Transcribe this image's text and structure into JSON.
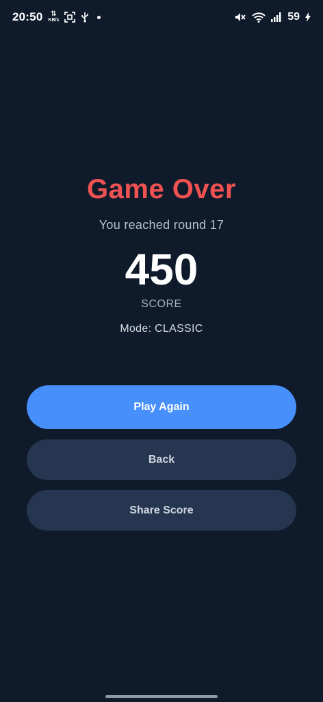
{
  "status_bar": {
    "time": "20:50",
    "net_speed_unit": "KB/s",
    "battery": "59"
  },
  "game_over": {
    "title": "Game Over",
    "subtitle": "You reached round 17",
    "score": "450",
    "score_label": "SCORE",
    "mode": "Mode: CLASSIC"
  },
  "buttons": {
    "play_again": "Play Again",
    "back": "Back",
    "share_score": "Share Score"
  },
  "colors": {
    "background": "#0f1b2b",
    "title": "#f05252",
    "primary_button": "#478ffb",
    "secondary_button": "#263650"
  }
}
